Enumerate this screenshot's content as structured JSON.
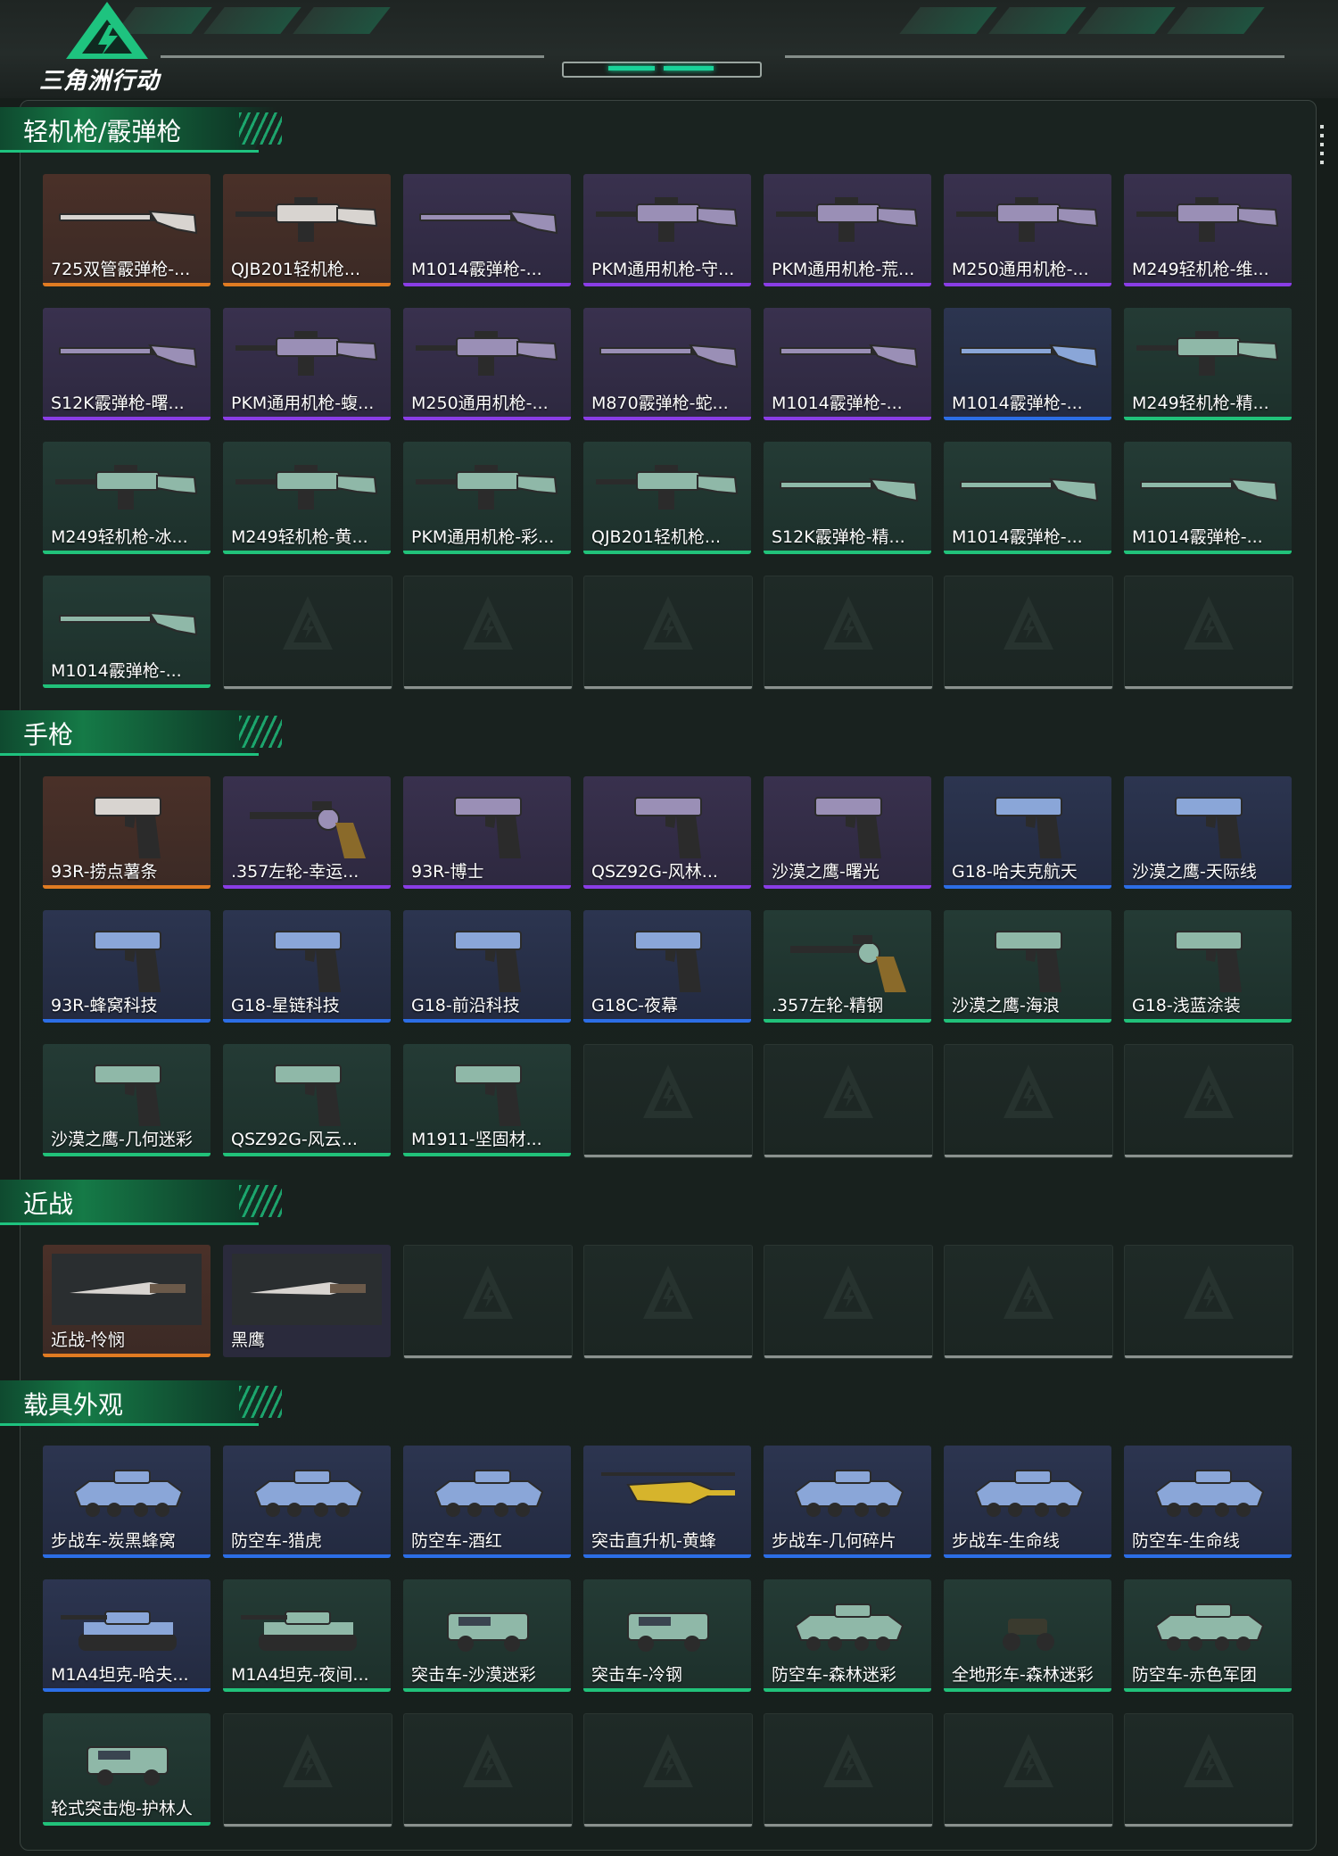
{
  "app": {
    "logo_text": "三角洲行动"
  },
  "colors": {
    "accent": "#1ec37f",
    "orange": "#e07b22",
    "purple": "#8a3de6",
    "blue": "#2c6ee6",
    "green": "#21c27a"
  },
  "sections": [
    {
      "title": "轻机枪/霰弹枪",
      "items": [
        {
          "name": "725双管霰弹枪-...",
          "rarity": "orange",
          "icon": "shotgun-icon"
        },
        {
          "name": "QJB201轻机枪...",
          "rarity": "orange",
          "icon": "lmg-icon"
        },
        {
          "name": "M1014霰弹枪-...",
          "rarity": "purple",
          "icon": "shotgun-icon"
        },
        {
          "name": "PKM通用机枪-守...",
          "rarity": "purple",
          "icon": "lmg-icon"
        },
        {
          "name": "PKM通用机枪-荒...",
          "rarity": "purple",
          "icon": "lmg-icon"
        },
        {
          "name": "M250通用机枪-...",
          "rarity": "purple",
          "icon": "lmg-icon"
        },
        {
          "name": "M249轻机枪-维...",
          "rarity": "purple",
          "icon": "lmg-icon"
        },
        {
          "name": "S12K霰弹枪-曙...",
          "rarity": "purple",
          "icon": "shotgun-icon"
        },
        {
          "name": "PKM通用机枪-蝮...",
          "rarity": "purple",
          "icon": "lmg-icon"
        },
        {
          "name": "M250通用机枪-...",
          "rarity": "purple",
          "icon": "lmg-icon"
        },
        {
          "name": "M870霰弹枪-蛇...",
          "rarity": "purple",
          "icon": "shotgun-icon"
        },
        {
          "name": "M1014霰弹枪-...",
          "rarity": "purple",
          "icon": "shotgun-icon"
        },
        {
          "name": "M1014霰弹枪-...",
          "rarity": "blue",
          "icon": "shotgun-icon"
        },
        {
          "name": "M249轻机枪-精...",
          "rarity": "green",
          "icon": "lmg-icon"
        },
        {
          "name": "M249轻机枪-冰...",
          "rarity": "green",
          "icon": "lmg-icon"
        },
        {
          "name": "M249轻机枪-黄...",
          "rarity": "green",
          "icon": "lmg-icon"
        },
        {
          "name": "PKM通用机枪-彩...",
          "rarity": "green",
          "icon": "lmg-icon"
        },
        {
          "name": "QJB201轻机枪...",
          "rarity": "green",
          "icon": "lmg-icon"
        },
        {
          "name": "S12K霰弹枪-精...",
          "rarity": "green",
          "icon": "shotgun-icon"
        },
        {
          "name": "M1014霰弹枪-...",
          "rarity": "green",
          "icon": "shotgun-icon"
        },
        {
          "name": "M1014霰弹枪-...",
          "rarity": "green",
          "icon": "shotgun-icon"
        },
        {
          "name": "M1014霰弹枪-...",
          "rarity": "green",
          "icon": "shotgun-icon"
        }
      ],
      "empty_slots": 6
    },
    {
      "title": "手枪",
      "items": [
        {
          "name": "93R-捞点薯条",
          "rarity": "orange",
          "icon": "pistol-icon"
        },
        {
          "name": ".357左轮-幸运...",
          "rarity": "purple",
          "icon": "revolver-icon"
        },
        {
          "name": "93R-博士",
          "rarity": "purple",
          "icon": "pistol-icon"
        },
        {
          "name": "QSZ92G-风林...",
          "rarity": "purple",
          "icon": "pistol-icon"
        },
        {
          "name": "沙漠之鹰-曙光",
          "rarity": "purple",
          "icon": "pistol-icon"
        },
        {
          "name": "G18-哈夫克航天",
          "rarity": "blue",
          "icon": "pistol-icon"
        },
        {
          "name": "沙漠之鹰-天际线",
          "rarity": "blue",
          "icon": "pistol-icon"
        },
        {
          "name": "93R-蜂窝科技",
          "rarity": "blue",
          "icon": "pistol-icon"
        },
        {
          "name": "G18-星链科技",
          "rarity": "blue",
          "icon": "pistol-icon"
        },
        {
          "name": "G18-前沿科技",
          "rarity": "blue",
          "icon": "pistol-icon"
        },
        {
          "name": "G18C-夜幕",
          "rarity": "blue",
          "icon": "pistol-icon"
        },
        {
          "name": ".357左轮-精钢",
          "rarity": "green",
          "icon": "revolver-icon"
        },
        {
          "name": "沙漠之鹰-海浪",
          "rarity": "green",
          "icon": "pistol-icon"
        },
        {
          "name": "G18-浅蓝涂装",
          "rarity": "green",
          "icon": "pistol-icon"
        },
        {
          "name": "沙漠之鹰-几何迷彩",
          "rarity": "green",
          "icon": "pistol-icon"
        },
        {
          "name": "QSZ92G-风云...",
          "rarity": "green",
          "icon": "pistol-icon"
        },
        {
          "name": "M1911-坚固材...",
          "rarity": "green",
          "icon": "pistol-icon"
        }
      ],
      "empty_slots": 4
    },
    {
      "title": "近战",
      "items": [
        {
          "name": "近战-怜悯",
          "rarity": "orange",
          "icon": "knife-icon"
        },
        {
          "name": "黑鹰",
          "rarity": "plain",
          "icon": "knife-icon"
        }
      ],
      "empty_slots": 5
    },
    {
      "title": "载具外观",
      "items": [
        {
          "name": "步战车-炭黑蜂窝",
          "rarity": "blue",
          "icon": "ifv-icon"
        },
        {
          "name": "防空车-猎虎",
          "rarity": "blue",
          "icon": "ifv-icon"
        },
        {
          "name": "防空车-酒红",
          "rarity": "blue",
          "icon": "ifv-icon"
        },
        {
          "name": "突击直升机-黄蜂",
          "rarity": "blue",
          "icon": "helicopter-icon"
        },
        {
          "name": "步战车-几何碎片",
          "rarity": "blue",
          "icon": "ifv-icon"
        },
        {
          "name": "步战车-生命线",
          "rarity": "blue",
          "icon": "ifv-icon"
        },
        {
          "name": "防空车-生命线",
          "rarity": "blue",
          "icon": "ifv-icon"
        },
        {
          "name": "M1A4坦克-哈夫...",
          "rarity": "blue",
          "icon": "tank-icon"
        },
        {
          "name": "M1A4坦克-夜间...",
          "rarity": "green",
          "icon": "tank-icon"
        },
        {
          "name": "突击车-沙漠迷彩",
          "rarity": "green",
          "icon": "jeep-icon"
        },
        {
          "name": "突击车-冷钢",
          "rarity": "green",
          "icon": "jeep-icon"
        },
        {
          "name": "防空车-森林迷彩",
          "rarity": "green",
          "icon": "ifv-icon"
        },
        {
          "name": "全地形车-森林迷彩",
          "rarity": "green",
          "icon": "atv-icon"
        },
        {
          "name": "防空车-赤色军团",
          "rarity": "green",
          "icon": "ifv-icon"
        },
        {
          "name": "轮式突击炮-护林人",
          "rarity": "green",
          "icon": "jeep-icon"
        }
      ],
      "empty_slots": 6
    }
  ]
}
